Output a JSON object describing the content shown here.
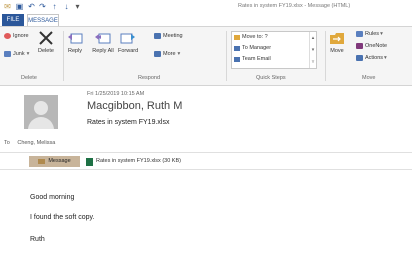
{
  "window": {
    "title": "Rates in system FY19.xlsx - Message (HTML)"
  },
  "qat": {
    "icons": [
      "mail-icon",
      "save-icon",
      "undo-icon",
      "redo-icon",
      "up-arrow-icon",
      "down-arrow-icon",
      "customize-icon"
    ]
  },
  "tabs": [
    {
      "label": "FILE"
    },
    {
      "label": "MESSAGE"
    }
  ],
  "ribbon": {
    "delete_group": {
      "ignore": "Ignore",
      "junk": "Junk",
      "delete": "Delete",
      "label": "Delete"
    },
    "respond_group": {
      "reply": "Reply",
      "reply_all": "Reply All",
      "forward": "Forward",
      "meeting": "Meeting",
      "more": "More",
      "label": "Respond"
    },
    "quick_steps": {
      "items": [
        "Move to: ?",
        "To Manager",
        "Team Email"
      ],
      "label": "Quick Steps"
    },
    "move_group": {
      "move": "Move",
      "rules": "Rules",
      "onenote": "OneNote",
      "actions": "Actions",
      "label": "Move"
    }
  },
  "message": {
    "date": "Fri 1/25/2019 10:15 AM",
    "sender": "Macgibbon, Ruth M",
    "subject": "Rates in system FY19.xlsx",
    "to_label": "To",
    "to": "Cheng, Melissa"
  },
  "attachments": {
    "message_tab": "Message",
    "file": "Rates in system FY19.xlsx (30 KB)"
  },
  "body": {
    "lines": [
      "Good morning",
      "I found the soft copy.",
      "Ruth"
    ]
  },
  "colors": {
    "accent": "#2b579a",
    "excel_green": "#1e7145"
  }
}
